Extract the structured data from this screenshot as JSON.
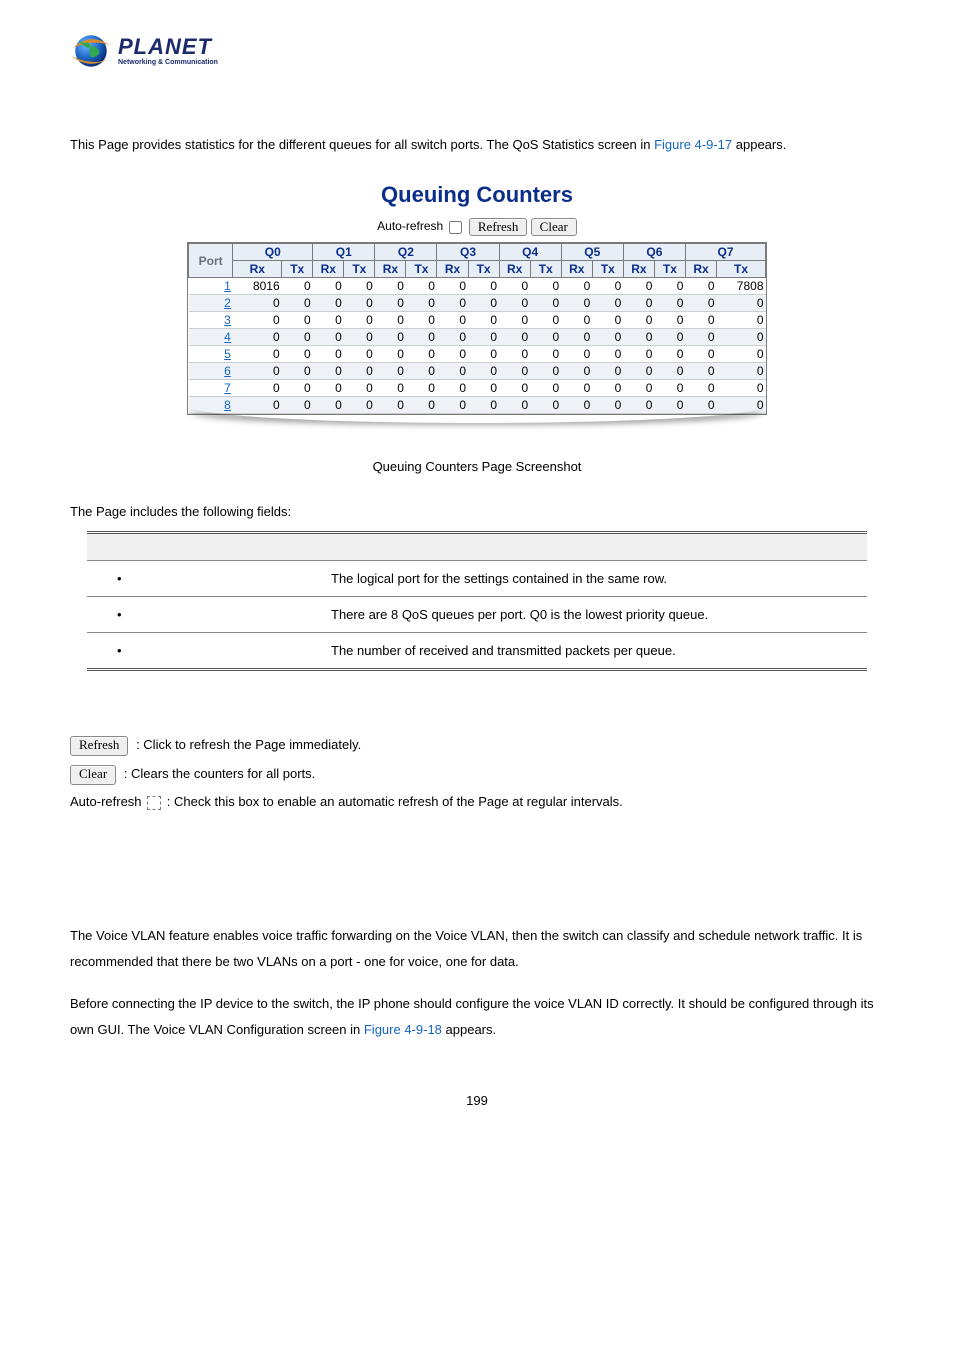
{
  "logo": {
    "brand": "PLANET",
    "tagline": "Networking & Communication"
  },
  "intro": {
    "pre": "This Page provides statistics for the different queues for all switch ports. The QoS Statistics screen in ",
    "fig": "Figure 4-9-17",
    "post": " appears."
  },
  "chart_title": "Queuing Counters",
  "controls": {
    "autorefresh_label": "Auto-refresh",
    "refresh_label": "Refresh",
    "clear_label": "Clear"
  },
  "chart_data": {
    "type": "table",
    "title": "Queuing Counters",
    "port_header": "Port",
    "queues": [
      "Q0",
      "Q1",
      "Q2",
      "Q3",
      "Q4",
      "Q5",
      "Q6",
      "Q7"
    ],
    "sub": [
      "Rx",
      "Tx"
    ],
    "rows": [
      {
        "port": "1",
        "cells": [
          8016,
          0,
          0,
          0,
          0,
          0,
          0,
          0,
          0,
          0,
          0,
          0,
          0,
          0,
          0,
          7808
        ]
      },
      {
        "port": "2",
        "cells": [
          0,
          0,
          0,
          0,
          0,
          0,
          0,
          0,
          0,
          0,
          0,
          0,
          0,
          0,
          0,
          0
        ]
      },
      {
        "port": "3",
        "cells": [
          0,
          0,
          0,
          0,
          0,
          0,
          0,
          0,
          0,
          0,
          0,
          0,
          0,
          0,
          0,
          0
        ]
      },
      {
        "port": "4",
        "cells": [
          0,
          0,
          0,
          0,
          0,
          0,
          0,
          0,
          0,
          0,
          0,
          0,
          0,
          0,
          0,
          0
        ]
      },
      {
        "port": "5",
        "cells": [
          0,
          0,
          0,
          0,
          0,
          0,
          0,
          0,
          0,
          0,
          0,
          0,
          0,
          0,
          0,
          0
        ]
      },
      {
        "port": "6",
        "cells": [
          0,
          0,
          0,
          0,
          0,
          0,
          0,
          0,
          0,
          0,
          0,
          0,
          0,
          0,
          0,
          0
        ]
      },
      {
        "port": "7",
        "cells": [
          0,
          0,
          0,
          0,
          0,
          0,
          0,
          0,
          0,
          0,
          0,
          0,
          0,
          0,
          0,
          0
        ]
      },
      {
        "port": "8",
        "cells": [
          0,
          0,
          0,
          0,
          0,
          0,
          0,
          0,
          0,
          0,
          0,
          0,
          0,
          0,
          0,
          0
        ]
      }
    ]
  },
  "caption": "Queuing Counters Page Screenshot",
  "fields_intro": "The Page includes the following fields:",
  "fields": {
    "rows": [
      {
        "desc": "The logical port for the settings contained in the same row."
      },
      {
        "desc": "There are 8 QoS queues per port. Q0 is the lowest priority queue."
      },
      {
        "desc": "The number of received and transmitted packets per queue."
      }
    ]
  },
  "buttons_help": {
    "refresh_btn": "Refresh",
    "refresh_text": ": Click to refresh the Page immediately.",
    "clear_btn": "Clear",
    "clear_text": ": Clears the counters for all ports.",
    "auto_label": "Auto-refresh",
    "auto_text": ": Check this box to enable an automatic refresh of the Page at regular intervals."
  },
  "voice": {
    "p1": "The Voice VLAN feature enables voice traffic forwarding on the Voice VLAN, then the switch can classify and schedule network traffic. It is recommended that there be two VLANs on a port - one for voice, one for data.",
    "p2_pre": "Before connecting the IP device to the switch, the IP phone should configure the voice VLAN ID correctly. It should be configured through its own GUI. The Voice VLAN Configuration screen in ",
    "p2_fig": "Figure 4-9-18",
    "p2_post": " appears."
  },
  "page_number": "199"
}
